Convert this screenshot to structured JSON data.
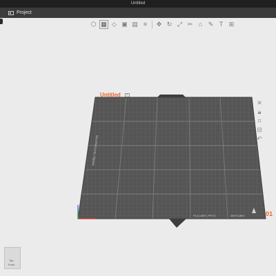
{
  "window": {
    "title": "Untitled"
  },
  "menu": {
    "project_label": "Project"
  },
  "toolbar": {
    "icons": [
      "cube-icon",
      "grid-icon",
      "orient-icon",
      "arrange-icon",
      "layers-icon",
      "slice-icon",
      "move-icon",
      "rotate-icon",
      "scale-icon",
      "cut-icon",
      "support-icon",
      "paint-icon",
      "text-icon",
      "measure-icon"
    ]
  },
  "plate": {
    "name": "Untitled",
    "number": "01",
    "side_text": "BAMBU TEXTURED PEI",
    "bottom_text_1": "PLA | ABS | PETG",
    "bottom_text_2": "ANYCUBIC"
  },
  "sidepanel": {
    "icons": [
      "close-plate-icon",
      "lock-icon",
      "camera-icon",
      "arrange-plate-icon",
      "rotate-plate-icon"
    ]
  },
  "viewcube": {
    "top": "Top",
    "front": "Front"
  }
}
